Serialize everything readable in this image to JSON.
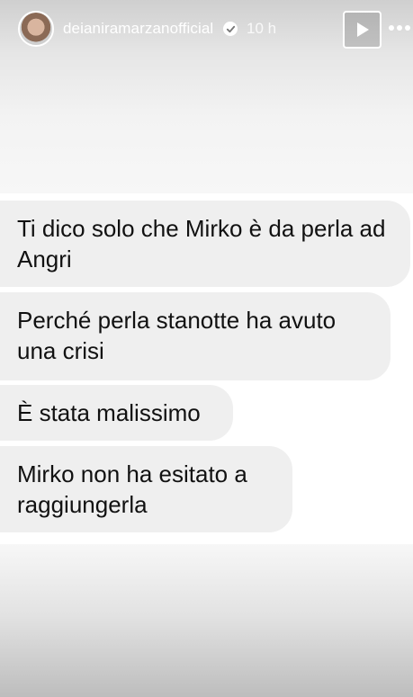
{
  "header": {
    "username": "deianiramarzanofficial",
    "time": "10 h",
    "icons": [
      "avatar",
      "verified-badge-icon",
      "play-icon",
      "more-icon"
    ]
  },
  "messages": [
    {
      "text": "Ti dico solo che Mirko è da perla ad Angri"
    },
    {
      "text": "Perché perla stanotte ha avuto una crisi"
    },
    {
      "text": "È stata malissimo"
    },
    {
      "text": "Mirko non ha esitato a raggiungerla"
    }
  ],
  "colors": {
    "bubble_bg": "#efefef",
    "text": "#111111",
    "header_text": "#ffffff"
  }
}
